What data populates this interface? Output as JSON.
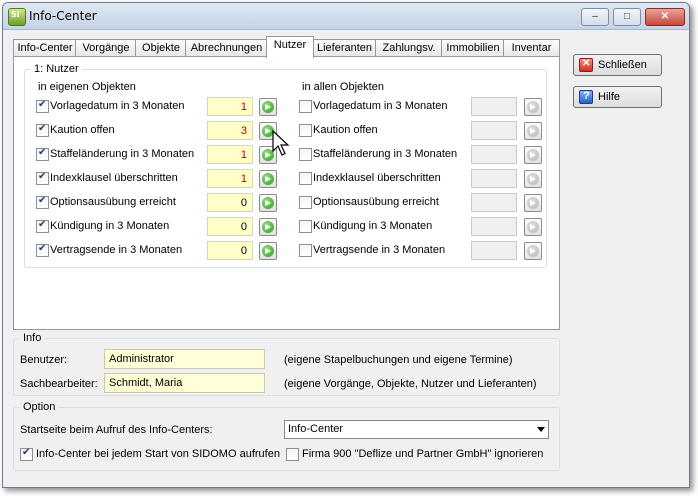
{
  "window": {
    "title": "Info-Center",
    "app_icon_text": "Si"
  },
  "titlebar_buttons": {
    "minimize": "–",
    "maximize": "□",
    "close": "✕"
  },
  "tabs": [
    {
      "label": "Info-Center",
      "active": false
    },
    {
      "label": "Vorgänge",
      "active": false
    },
    {
      "label": "Objekte",
      "active": false
    },
    {
      "label": "Abrechnungen",
      "active": false
    },
    {
      "label": "Nutzer",
      "active": true
    },
    {
      "label": "Lieferanten",
      "active": false
    },
    {
      "label": "Zahlungsv.",
      "active": false
    },
    {
      "label": "Immobilien",
      "active": false
    },
    {
      "label": "Inventar",
      "active": false
    }
  ],
  "nutzer": {
    "group_label": "1: Nutzer",
    "left_header": "in eigenen Objekten",
    "right_header": "in allen Objekten",
    "rows": [
      {
        "label": "Vorlagedatum in 3 Monaten",
        "left_checked": true,
        "value": "1",
        "highlight": true,
        "right_checked": false
      },
      {
        "label": "Kaution offen",
        "left_checked": true,
        "value": "3",
        "highlight": true,
        "right_checked": false
      },
      {
        "label": "Staffeländerung in 3 Monaten",
        "left_checked": true,
        "value": "1",
        "highlight": true,
        "right_checked": false
      },
      {
        "label": "Indexklausel überschritten",
        "left_checked": true,
        "value": "1",
        "highlight": true,
        "right_checked": false
      },
      {
        "label": "Optionsausübung erreicht",
        "left_checked": true,
        "value": "0",
        "highlight": false,
        "right_checked": false
      },
      {
        "label": "Kündigung in 3 Monaten",
        "left_checked": true,
        "value": "0",
        "highlight": false,
        "right_checked": false
      },
      {
        "label": "Vertragsende in 3 Monaten",
        "left_checked": true,
        "value": "0",
        "highlight": false,
        "right_checked": false
      }
    ]
  },
  "info": {
    "group_label": "Info",
    "benutzer_label": "Benutzer:",
    "benutzer_value": "Administrator",
    "benutzer_note": "(eigene Stapelbuchungen und eigene Termine)",
    "sachbearbeiter_label": "Sachbearbeiter:",
    "sachbearbeiter_value": "Schmidt, Maria",
    "sachbearbeiter_note": "(eigene Vorgänge, Objekte, Nutzer und Lieferanten)"
  },
  "option": {
    "group_label": "Option",
    "startseite_label": "Startseite beim Aufruf des Info-Centers:",
    "startseite_value": "Info-Center",
    "autostart_label": "Info-Center bei jedem Start von SIDOMO aufrufen",
    "autostart_checked": true,
    "ignore_label": "Firma 900 \"Deflize und Partner GmbH\" ignorieren",
    "ignore_checked": false
  },
  "buttons": {
    "close_label": "Schließen",
    "help_label": "Hilfe"
  },
  "colors": {
    "highlight_value": "#c00000",
    "field_bg": "#ffffc8",
    "accent": "#2e9a1e"
  }
}
